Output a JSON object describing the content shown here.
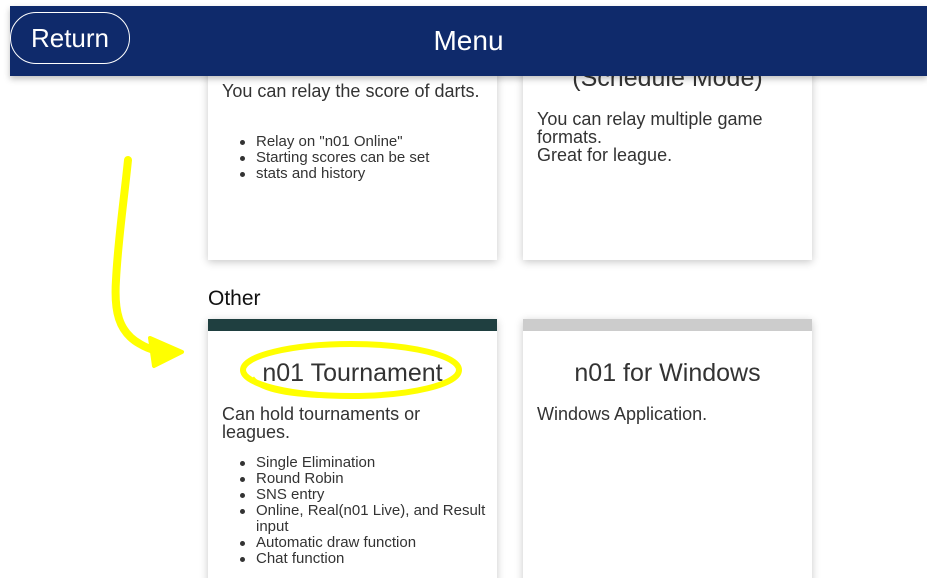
{
  "header": {
    "return_label": "Return",
    "title": "Menu",
    "background_color": "#0f2a6b"
  },
  "cards_top": [
    {
      "title_partial": "",
      "description": "You can relay the score of darts.",
      "bullets": [
        "Relay on \"n01 Online\"",
        "Starting scores can be set",
        "stats and history"
      ]
    },
    {
      "title_partial": "(Schedule Mode)",
      "description": "You can relay multiple game formats.\nGreat for league.",
      "bullets": []
    }
  ],
  "section_other": {
    "label": "Other",
    "cards": [
      {
        "title": "n01 Tournament",
        "strip_color": "#1f3f40",
        "description": "Can hold tournaments or leagues.",
        "bullets": [
          "Single Elimination",
          "Round Robin",
          "SNS entry",
          "Online, Real(n01 Live), and Result input",
          "Automatic draw function",
          "Chat function"
        ]
      },
      {
        "title": "n01 for Windows",
        "strip_color": "#cccccc",
        "description": "Windows Application.",
        "bullets": []
      }
    ]
  },
  "annotation": {
    "color": "#ffff00",
    "description": "hand-drawn highlight circling n01 Tournament with arrow"
  }
}
